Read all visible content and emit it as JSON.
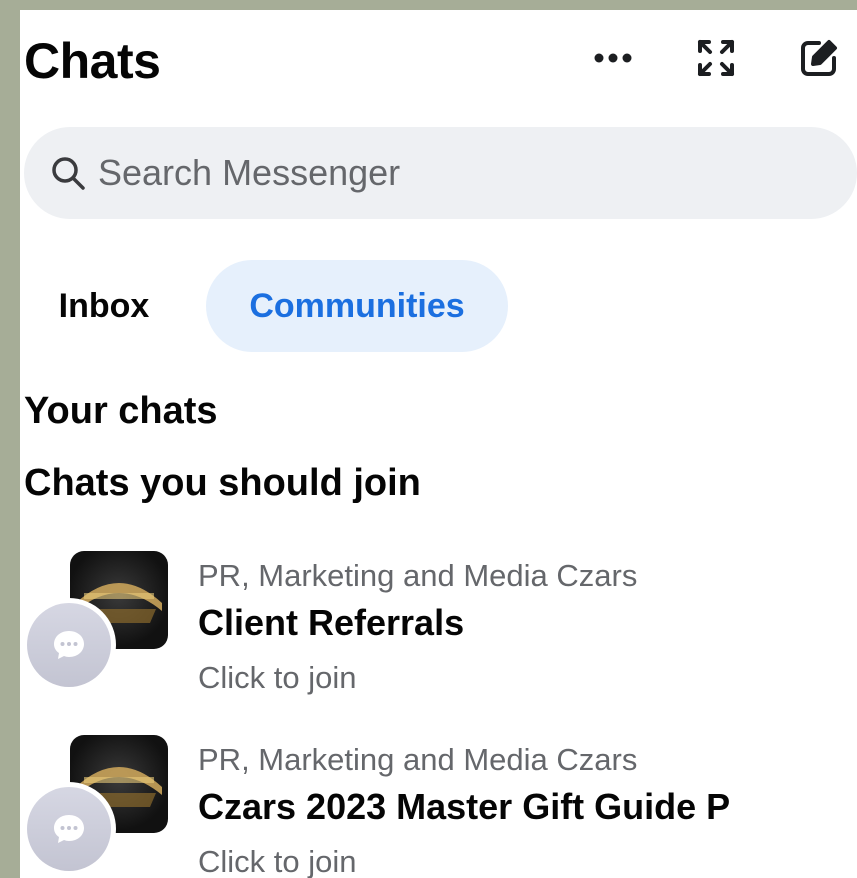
{
  "header": {
    "title": "Chats",
    "icons": [
      "more-dots-icon",
      "expand-icon",
      "compose-icon"
    ]
  },
  "search": {
    "placeholder": "Search Messenger",
    "icon": "search-icon"
  },
  "tabs": [
    {
      "label": "Inbox",
      "selected": false
    },
    {
      "label": "Communities",
      "selected": true
    }
  ],
  "sections": {
    "your_chats": "Your chats",
    "suggested": "Chats you should join"
  },
  "suggested_chats": [
    {
      "community": "PR, Marketing and Media Czars",
      "name": "Client Referrals",
      "action": "Click to join"
    },
    {
      "community": "PR, Marketing and Media Czars",
      "name": "Czars 2023 Master Gift Guide P",
      "action": "Click to join"
    }
  ],
  "colors": {
    "accent": "#1b6fe0",
    "selected_tab_bg": "#e6f0fc",
    "search_bg": "#eef0f3",
    "secondary_text": "#65676b",
    "frame": "#a6ad97"
  }
}
